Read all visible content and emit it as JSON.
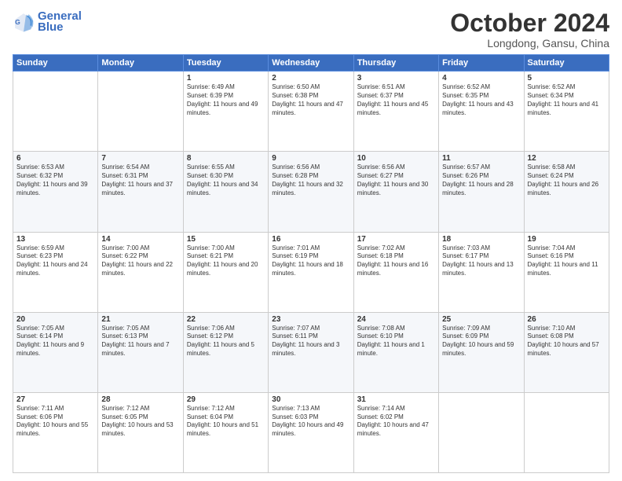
{
  "header": {
    "logo_line1": "General",
    "logo_line2": "Blue",
    "month": "October 2024",
    "location": "Longdong, Gansu, China"
  },
  "weekdays": [
    "Sunday",
    "Monday",
    "Tuesday",
    "Wednesday",
    "Thursday",
    "Friday",
    "Saturday"
  ],
  "weeks": [
    [
      {
        "day": "",
        "sunrise": "",
        "sunset": "",
        "daylight": ""
      },
      {
        "day": "",
        "sunrise": "",
        "sunset": "",
        "daylight": ""
      },
      {
        "day": "1",
        "sunrise": "Sunrise: 6:49 AM",
        "sunset": "Sunset: 6:39 PM",
        "daylight": "Daylight: 11 hours and 49 minutes."
      },
      {
        "day": "2",
        "sunrise": "Sunrise: 6:50 AM",
        "sunset": "Sunset: 6:38 PM",
        "daylight": "Daylight: 11 hours and 47 minutes."
      },
      {
        "day": "3",
        "sunrise": "Sunrise: 6:51 AM",
        "sunset": "Sunset: 6:37 PM",
        "daylight": "Daylight: 11 hours and 45 minutes."
      },
      {
        "day": "4",
        "sunrise": "Sunrise: 6:52 AM",
        "sunset": "Sunset: 6:35 PM",
        "daylight": "Daylight: 11 hours and 43 minutes."
      },
      {
        "day": "5",
        "sunrise": "Sunrise: 6:52 AM",
        "sunset": "Sunset: 6:34 PM",
        "daylight": "Daylight: 11 hours and 41 minutes."
      }
    ],
    [
      {
        "day": "6",
        "sunrise": "Sunrise: 6:53 AM",
        "sunset": "Sunset: 6:32 PM",
        "daylight": "Daylight: 11 hours and 39 minutes."
      },
      {
        "day": "7",
        "sunrise": "Sunrise: 6:54 AM",
        "sunset": "Sunset: 6:31 PM",
        "daylight": "Daylight: 11 hours and 37 minutes."
      },
      {
        "day": "8",
        "sunrise": "Sunrise: 6:55 AM",
        "sunset": "Sunset: 6:30 PM",
        "daylight": "Daylight: 11 hours and 34 minutes."
      },
      {
        "day": "9",
        "sunrise": "Sunrise: 6:56 AM",
        "sunset": "Sunset: 6:28 PM",
        "daylight": "Daylight: 11 hours and 32 minutes."
      },
      {
        "day": "10",
        "sunrise": "Sunrise: 6:56 AM",
        "sunset": "Sunset: 6:27 PM",
        "daylight": "Daylight: 11 hours and 30 minutes."
      },
      {
        "day": "11",
        "sunrise": "Sunrise: 6:57 AM",
        "sunset": "Sunset: 6:26 PM",
        "daylight": "Daylight: 11 hours and 28 minutes."
      },
      {
        "day": "12",
        "sunrise": "Sunrise: 6:58 AM",
        "sunset": "Sunset: 6:24 PM",
        "daylight": "Daylight: 11 hours and 26 minutes."
      }
    ],
    [
      {
        "day": "13",
        "sunrise": "Sunrise: 6:59 AM",
        "sunset": "Sunset: 6:23 PM",
        "daylight": "Daylight: 11 hours and 24 minutes."
      },
      {
        "day": "14",
        "sunrise": "Sunrise: 7:00 AM",
        "sunset": "Sunset: 6:22 PM",
        "daylight": "Daylight: 11 hours and 22 minutes."
      },
      {
        "day": "15",
        "sunrise": "Sunrise: 7:00 AM",
        "sunset": "Sunset: 6:21 PM",
        "daylight": "Daylight: 11 hours and 20 minutes."
      },
      {
        "day": "16",
        "sunrise": "Sunrise: 7:01 AM",
        "sunset": "Sunset: 6:19 PM",
        "daylight": "Daylight: 11 hours and 18 minutes."
      },
      {
        "day": "17",
        "sunrise": "Sunrise: 7:02 AM",
        "sunset": "Sunset: 6:18 PM",
        "daylight": "Daylight: 11 hours and 16 minutes."
      },
      {
        "day": "18",
        "sunrise": "Sunrise: 7:03 AM",
        "sunset": "Sunset: 6:17 PM",
        "daylight": "Daylight: 11 hours and 13 minutes."
      },
      {
        "day": "19",
        "sunrise": "Sunrise: 7:04 AM",
        "sunset": "Sunset: 6:16 PM",
        "daylight": "Daylight: 11 hours and 11 minutes."
      }
    ],
    [
      {
        "day": "20",
        "sunrise": "Sunrise: 7:05 AM",
        "sunset": "Sunset: 6:14 PM",
        "daylight": "Daylight: 11 hours and 9 minutes."
      },
      {
        "day": "21",
        "sunrise": "Sunrise: 7:05 AM",
        "sunset": "Sunset: 6:13 PM",
        "daylight": "Daylight: 11 hours and 7 minutes."
      },
      {
        "day": "22",
        "sunrise": "Sunrise: 7:06 AM",
        "sunset": "Sunset: 6:12 PM",
        "daylight": "Daylight: 11 hours and 5 minutes."
      },
      {
        "day": "23",
        "sunrise": "Sunrise: 7:07 AM",
        "sunset": "Sunset: 6:11 PM",
        "daylight": "Daylight: 11 hours and 3 minutes."
      },
      {
        "day": "24",
        "sunrise": "Sunrise: 7:08 AM",
        "sunset": "Sunset: 6:10 PM",
        "daylight": "Daylight: 11 hours and 1 minute."
      },
      {
        "day": "25",
        "sunrise": "Sunrise: 7:09 AM",
        "sunset": "Sunset: 6:09 PM",
        "daylight": "Daylight: 10 hours and 59 minutes."
      },
      {
        "day": "26",
        "sunrise": "Sunrise: 7:10 AM",
        "sunset": "Sunset: 6:08 PM",
        "daylight": "Daylight: 10 hours and 57 minutes."
      }
    ],
    [
      {
        "day": "27",
        "sunrise": "Sunrise: 7:11 AM",
        "sunset": "Sunset: 6:06 PM",
        "daylight": "Daylight: 10 hours and 55 minutes."
      },
      {
        "day": "28",
        "sunrise": "Sunrise: 7:12 AM",
        "sunset": "Sunset: 6:05 PM",
        "daylight": "Daylight: 10 hours and 53 minutes."
      },
      {
        "day": "29",
        "sunrise": "Sunrise: 7:12 AM",
        "sunset": "Sunset: 6:04 PM",
        "daylight": "Daylight: 10 hours and 51 minutes."
      },
      {
        "day": "30",
        "sunrise": "Sunrise: 7:13 AM",
        "sunset": "Sunset: 6:03 PM",
        "daylight": "Daylight: 10 hours and 49 minutes."
      },
      {
        "day": "31",
        "sunrise": "Sunrise: 7:14 AM",
        "sunset": "Sunset: 6:02 PM",
        "daylight": "Daylight: 10 hours and 47 minutes."
      },
      {
        "day": "",
        "sunrise": "",
        "sunset": "",
        "daylight": ""
      },
      {
        "day": "",
        "sunrise": "",
        "sunset": "",
        "daylight": ""
      }
    ]
  ]
}
